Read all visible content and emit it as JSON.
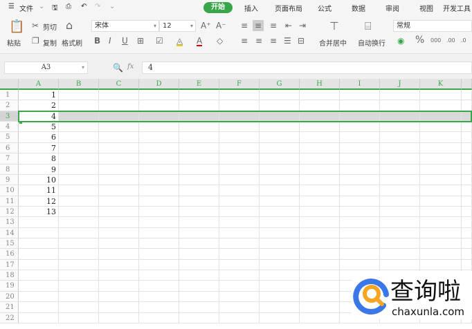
{
  "menubar": {
    "menu_icon": "hamburger-icon",
    "file": "文件",
    "tabs": [
      "开始",
      "插入",
      "页面布局",
      "公式",
      "数据",
      "审阅",
      "视图",
      "开发工具"
    ],
    "active_tab": "开始"
  },
  "ribbon": {
    "paste": "粘贴",
    "cut": "剪切",
    "copy": "复制",
    "format_painter": "格式刷",
    "font_name": "宋体",
    "font_size": "12",
    "merge_center": "合并居中",
    "wrap_text": "自动换行",
    "number_format": "常规",
    "percent": "%"
  },
  "formula_bar": {
    "name_box": "A3",
    "fx": "fx",
    "value": "4"
  },
  "sheet": {
    "columns": [
      "A",
      "B",
      "C",
      "D",
      "E",
      "F",
      "G",
      "H",
      "I",
      "J",
      "K"
    ],
    "row_count": 22,
    "column_a_values": [
      "1",
      "2",
      "4",
      "5",
      "6",
      "7",
      "8",
      "9",
      "10",
      "11",
      "12",
      "13"
    ],
    "selected_row": 3
  },
  "accent": "#3aa64a",
  "watermark": {
    "name": "查询啦",
    "url": "chaxunla.com"
  }
}
